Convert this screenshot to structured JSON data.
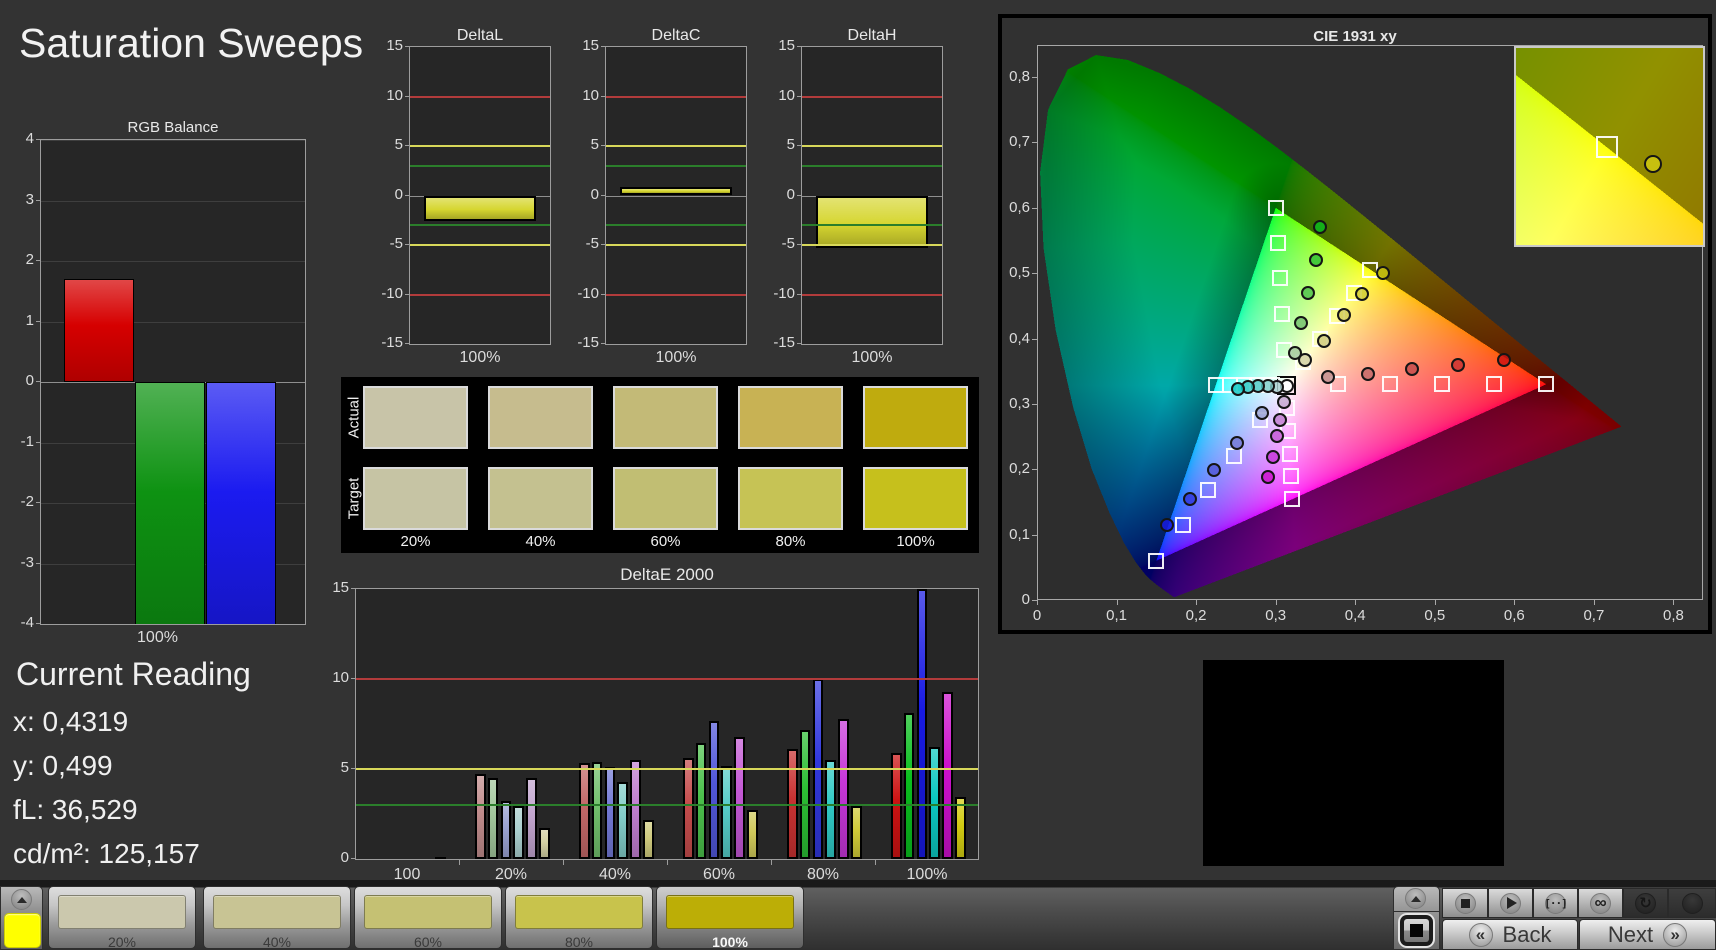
{
  "app": {
    "title": "Saturation Sweeps"
  },
  "current_reading": {
    "title": "Current Reading",
    "items": [
      {
        "label": "x:",
        "value": "0,4319"
      },
      {
        "label": "y:",
        "value": "0,499"
      },
      {
        "label": "fL:",
        "value": "36,529"
      },
      {
        "label": "cd/m²:",
        "value": "125,157"
      }
    ]
  },
  "nav": {
    "back": "Back",
    "next": "Next"
  },
  "transport_icons": [
    "collapse-up",
    "pattern-window",
    "stop",
    "play",
    "pattern-range",
    "loop",
    "refresh",
    "record"
  ],
  "swatch_panel": {
    "row_labels": [
      "Actual",
      "Target"
    ],
    "col_labels": [
      "20%",
      "40%",
      "60%",
      "80%",
      "100%"
    ],
    "actual_colors": [
      "#c8c4a8",
      "#c6bc8e",
      "#c3ba77",
      "#c8b254",
      "#bfab0e"
    ],
    "target_colors": [
      "#c6c4a4",
      "#c4c190",
      "#c1be73",
      "#c6c355",
      "#c6c01c"
    ]
  },
  "pattern_bar": {
    "current_color": "#ffff00",
    "selected": "100%",
    "buttons": [
      {
        "label": "20%",
        "color": "#cbc8ad"
      },
      {
        "label": "40%",
        "color": "#c8c494"
      },
      {
        "label": "60%",
        "color": "#c5c173"
      },
      {
        "label": "80%",
        "color": "#c8c34c"
      },
      {
        "label": "100%",
        "color": "#bcae06"
      }
    ]
  },
  "chart_data": [
    {
      "id": "rgb_balance",
      "type": "bar",
      "title": "RGB Balance",
      "xlabel": "100%",
      "ylim": [
        -4,
        4
      ],
      "yticks": [
        -4,
        -3,
        -2,
        -1,
        0,
        1,
        2,
        3,
        4
      ],
      "categories": [
        "Red",
        "Green",
        "Blue"
      ],
      "values": [
        1.7,
        -4.3,
        -4.3
      ],
      "bar_colors": [
        "#d60000",
        "#0e9212",
        "#1b1bf0"
      ]
    },
    {
      "id": "deltaL",
      "type": "bar",
      "title": "DeltaL",
      "xlabel": "100%",
      "ylim": [
        -15,
        15
      ],
      "yticks": [
        -15,
        -10,
        -5,
        0,
        5,
        10,
        15
      ],
      "ref_lines": [
        {
          "value": 10,
          "color": "#b23b3b"
        },
        {
          "value": 5,
          "color": "#d8d85a"
        },
        {
          "value": 3,
          "color": "#2b7e2b"
        },
        {
          "value": -3,
          "color": "#2b7e2b"
        },
        {
          "value": -5,
          "color": "#d8d85a"
        },
        {
          "value": -10,
          "color": "#b23b3b"
        }
      ],
      "categories": [
        "100%"
      ],
      "values": [
        -2.6
      ],
      "bar_color": "#d6d630"
    },
    {
      "id": "deltaC",
      "type": "bar",
      "title": "DeltaC",
      "xlabel": "100%",
      "ylim": [
        -15,
        15
      ],
      "yticks": [
        -15,
        -10,
        -5,
        0,
        5,
        10,
        15
      ],
      "ref_lines": [
        {
          "value": 10,
          "color": "#b23b3b"
        },
        {
          "value": 5,
          "color": "#d8d85a"
        },
        {
          "value": 3,
          "color": "#2b7e2b"
        },
        {
          "value": -3,
          "color": "#2b7e2b"
        },
        {
          "value": -5,
          "color": "#d8d85a"
        },
        {
          "value": -10,
          "color": "#b23b3b"
        }
      ],
      "categories": [
        "100%"
      ],
      "values": [
        0.9
      ],
      "bar_color": "#d6d630"
    },
    {
      "id": "deltaH",
      "type": "bar",
      "title": "DeltaH",
      "xlabel": "100%",
      "ylim": [
        -15,
        15
      ],
      "yticks": [
        -15,
        -10,
        -5,
        0,
        5,
        10,
        15
      ],
      "ref_lines": [
        {
          "value": 10,
          "color": "#b23b3b"
        },
        {
          "value": 5,
          "color": "#d8d85a"
        },
        {
          "value": 3,
          "color": "#2b7e2b"
        },
        {
          "value": -3,
          "color": "#2b7e2b"
        },
        {
          "value": -5,
          "color": "#d8d85a"
        },
        {
          "value": -10,
          "color": "#b23b3b"
        }
      ],
      "categories": [
        "100%"
      ],
      "values": [
        -5.3
      ],
      "bar_color": "#d6d630"
    },
    {
      "id": "deltae2000",
      "type": "bar",
      "title": "DeltaE 2000",
      "ylim": [
        0,
        15
      ],
      "yticks": [
        0,
        5,
        10,
        15
      ],
      "ref_lines": [
        {
          "value": 10,
          "color": "#b23b3b"
        },
        {
          "value": 5,
          "color": "#d8d85a"
        },
        {
          "value": 3,
          "color": "#2b7e2b"
        }
      ],
      "categories": [
        "100",
        "20%",
        "40%",
        "60%",
        "80%",
        "100%"
      ],
      "series_labels": [
        "Red",
        "Green",
        "Blue",
        "Cyan",
        "Magenta",
        "Yellow"
      ],
      "groups": [
        {
          "label": "100",
          "values": [
            0,
            0,
            0,
            0,
            0,
            0.12
          ],
          "colors": [
            "#e6e6de",
            "#e6e6de",
            "#e6e6de",
            "#e6e6de",
            "#e6e6de",
            "#e6e6de"
          ]
        },
        {
          "label": "20%",
          "values": [
            4.7,
            4.5,
            3.2,
            2.95,
            4.5,
            1.7
          ],
          "colors": [
            "#c08c8c",
            "#a2c79c",
            "#9aa2d2",
            "#abd0cf",
            "#c2a5ce",
            "#d2cfa2"
          ]
        },
        {
          "label": "40%",
          "values": [
            5.35,
            5.4,
            5.1,
            4.3,
            5.5,
            2.15
          ],
          "colors": [
            "#c26868",
            "#72c06c",
            "#7379d4",
            "#82cdc9",
            "#c17fd0",
            "#cfca7e"
          ]
        },
        {
          "label": "60%",
          "values": [
            5.6,
            6.45,
            7.65,
            5.15,
            6.8,
            2.75
          ],
          "colors": [
            "#c54c4c",
            "#4cc04c",
            "#5157d8",
            "#55cbc7",
            "#c358d4",
            "#cfc95a"
          ]
        },
        {
          "label": "80%",
          "values": [
            6.1,
            7.15,
            10.0,
            5.5,
            7.8,
            2.95
          ],
          "colors": [
            "#c83232",
            "#2cbe34",
            "#3138dc",
            "#30c9c4",
            "#c636d8",
            "#d0ca38"
          ]
        },
        {
          "label": "100%",
          "values": [
            5.9,
            8.1,
            15.6,
            6.2,
            9.3,
            3.45
          ],
          "colors": [
            "#cc1212",
            "#0abe1e",
            "#181ae2",
            "#0cc7c1",
            "#cc10cc",
            "#d2cc12"
          ]
        }
      ]
    },
    {
      "id": "cie",
      "type": "scatter",
      "title": "CIE 1931 xy",
      "xlim": [
        0,
        0.8
      ],
      "ylim": [
        0,
        0.85
      ],
      "xtick_labels": [
        "0",
        "0,1",
        "0,2",
        "0,3",
        "0,4",
        "0,5",
        "0,6",
        "0,7",
        "0,8"
      ],
      "ytick_labels": [
        "0",
        "0,1",
        "0,2",
        "0,3",
        "0,4",
        "0,5",
        "0,6",
        "0,7",
        "0,8"
      ],
      "gamut_triangle": [
        [
          0.64,
          0.33
        ],
        [
          0.3,
          0.6
        ],
        [
          0.15,
          0.06
        ]
      ],
      "white_point": [
        0.3127,
        0.329
      ],
      "targets": {
        "white": [
          [
            0.3127,
            0.329
          ]
        ],
        "red": [
          [
            0.378,
            0.33
          ],
          [
            0.444,
            0.33
          ],
          [
            0.509,
            0.33
          ],
          [
            0.575,
            0.33
          ],
          [
            0.64,
            0.33
          ]
        ],
        "green": [
          [
            0.31,
            0.383
          ],
          [
            0.308,
            0.437
          ],
          [
            0.305,
            0.492
          ],
          [
            0.303,
            0.546
          ],
          [
            0.3,
            0.6
          ]
        ],
        "blue": [
          [
            0.28,
            0.275
          ],
          [
            0.248,
            0.221
          ],
          [
            0.215,
            0.168
          ],
          [
            0.183,
            0.114
          ],
          [
            0.15,
            0.06
          ]
        ],
        "cyan": [
          [
            0.295,
            0.329
          ],
          [
            0.277,
            0.329
          ],
          [
            0.26,
            0.329
          ],
          [
            0.242,
            0.329
          ],
          [
            0.225,
            0.329
          ]
        ],
        "magenta": [
          [
            0.314,
            0.294
          ],
          [
            0.316,
            0.259
          ],
          [
            0.318,
            0.224
          ],
          [
            0.319,
            0.189
          ],
          [
            0.321,
            0.154
          ]
        ],
        "yellow": [
          [
            0.334,
            0.364
          ],
          [
            0.356,
            0.399
          ],
          [
            0.377,
            0.435
          ],
          [
            0.398,
            0.47
          ],
          [
            0.419,
            0.505
          ]
        ]
      },
      "measured": {
        "white": [
          [
            0.3127,
            0.329
          ]
        ],
        "red": [
          [
            0.364,
            0.342
          ],
          [
            0.415,
            0.347
          ],
          [
            0.47,
            0.355
          ],
          [
            0.528,
            0.361
          ],
          [
            0.586,
            0.368
          ]
        ],
        "green": [
          [
            0.3226,
            0.38
          ],
          [
            0.33,
            0.426
          ],
          [
            0.339,
            0.472
          ],
          [
            0.349,
            0.521
          ],
          [
            0.355,
            0.572
          ]
        ],
        "blue": [
          [
            0.282,
            0.287
          ],
          [
            0.25,
            0.242
          ],
          [
            0.221,
            0.201
          ],
          [
            0.191,
            0.156
          ],
          [
            0.162,
            0.116
          ]
        ],
        "cyan": [
          [
            0.301,
            0.328
          ],
          [
            0.289,
            0.329
          ],
          [
            0.276,
            0.329
          ],
          [
            0.264,
            0.328
          ],
          [
            0.251,
            0.325
          ]
        ],
        "magenta": [
          [
            0.309,
            0.304
          ],
          [
            0.304,
            0.277
          ],
          [
            0.3,
            0.252
          ],
          [
            0.295,
            0.221
          ],
          [
            0.289,
            0.19
          ]
        ],
        "yellow": [
          [
            0.336,
            0.369
          ],
          [
            0.36,
            0.398
          ],
          [
            0.385,
            0.437
          ],
          [
            0.407,
            0.47
          ],
          [
            0.434,
            0.502
          ]
        ]
      },
      "inset": {
        "window": [
          0.39,
          0.474,
          0.45,
          0.5372
        ],
        "target": [
          0.4193,
          0.5053
        ],
        "measured": [
          0.434,
          0.5
        ]
      }
    }
  ]
}
